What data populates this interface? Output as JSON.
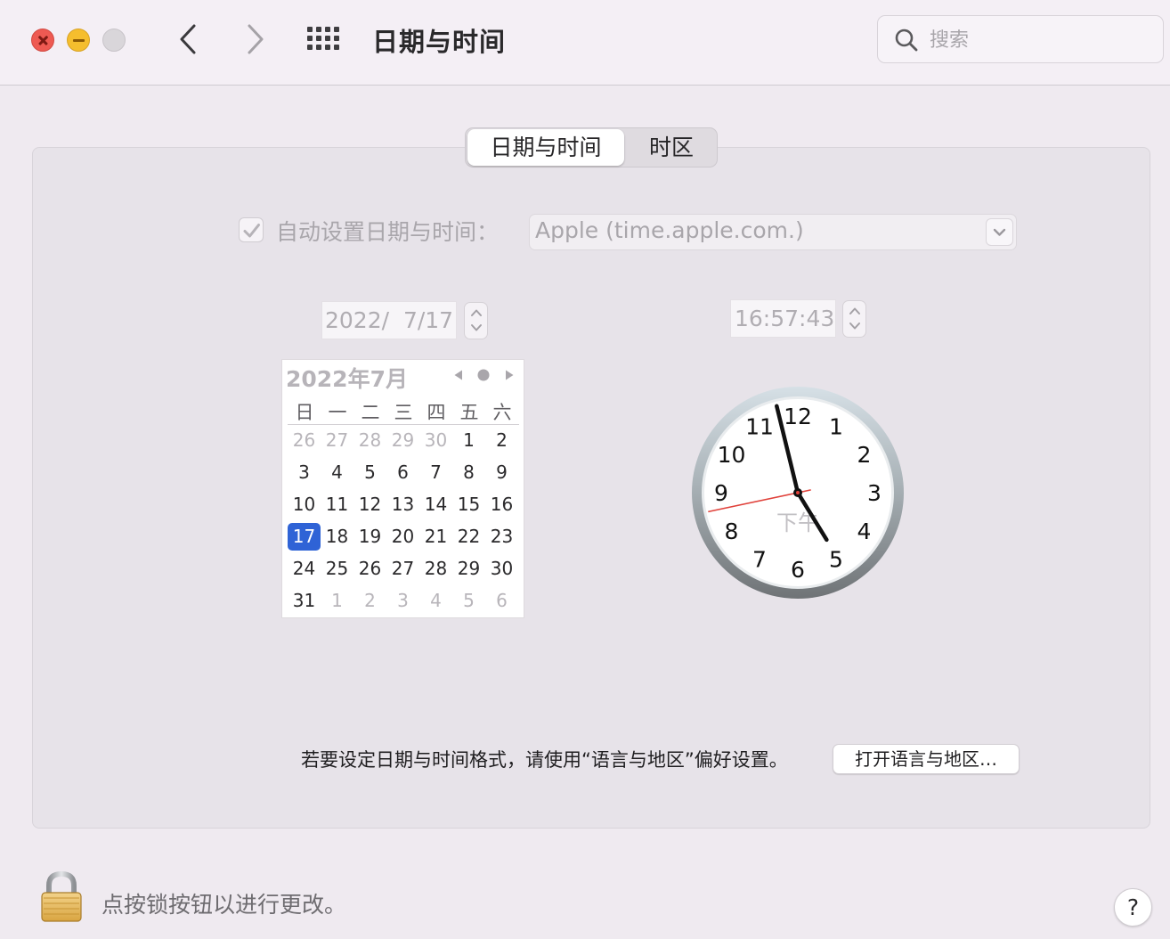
{
  "window": {
    "title": "日期与时间",
    "search_placeholder": "搜索"
  },
  "tabs": [
    {
      "label": "日期与时间",
      "active": true
    },
    {
      "label": "时区",
      "active": false
    }
  ],
  "auto_time": {
    "label": "自动设置日期与时间：",
    "checked": true,
    "server": "Apple (time.apple.com.)"
  },
  "date_field": "2022/  7/17",
  "time_field": "16:57:43",
  "calendar": {
    "title": "2022年7月",
    "weekdays": [
      "日",
      "一",
      "二",
      "三",
      "四",
      "五",
      "六"
    ],
    "weeks": [
      [
        {
          "d": "26",
          "m": true
        },
        {
          "d": "27",
          "m": true
        },
        {
          "d": "28",
          "m": true
        },
        {
          "d": "29",
          "m": true
        },
        {
          "d": "30",
          "m": true
        },
        {
          "d": "1"
        },
        {
          "d": "2"
        }
      ],
      [
        {
          "d": "3"
        },
        {
          "d": "4"
        },
        {
          "d": "5"
        },
        {
          "d": "6"
        },
        {
          "d": "7"
        },
        {
          "d": "8"
        },
        {
          "d": "9"
        }
      ],
      [
        {
          "d": "10"
        },
        {
          "d": "11"
        },
        {
          "d": "12"
        },
        {
          "d": "13"
        },
        {
          "d": "14"
        },
        {
          "d": "15"
        },
        {
          "d": "16"
        }
      ],
      [
        {
          "d": "17",
          "s": true
        },
        {
          "d": "18"
        },
        {
          "d": "19"
        },
        {
          "d": "20"
        },
        {
          "d": "21"
        },
        {
          "d": "22"
        },
        {
          "d": "23"
        }
      ],
      [
        {
          "d": "24"
        },
        {
          "d": "25"
        },
        {
          "d": "26"
        },
        {
          "d": "27"
        },
        {
          "d": "28"
        },
        {
          "d": "29"
        },
        {
          "d": "30"
        }
      ],
      [
        {
          "d": "31"
        },
        {
          "d": "1",
          "m": true
        },
        {
          "d": "2",
          "m": true
        },
        {
          "d": "3",
          "m": true
        },
        {
          "d": "4",
          "m": true
        },
        {
          "d": "5",
          "m": true
        },
        {
          "d": "6",
          "m": true
        }
      ]
    ]
  },
  "clock": {
    "numbers": [
      "12",
      "1",
      "2",
      "3",
      "4",
      "5",
      "6",
      "7",
      "8",
      "9",
      "10",
      "11"
    ],
    "ampm": "下午",
    "hour": 4,
    "minute": 57,
    "second": 43
  },
  "format_note": "若要设定日期与时间格式，请使用“语言与地区”偏好设置。",
  "open_language_button": "打开语言与地区…",
  "lock_text": "点按锁按钮以进行更改。",
  "help_label": "?",
  "colors": {
    "selected_day": "#2f63d6",
    "second_hand": "#e0413a",
    "close": "#ee5a52",
    "minimize": "#f5be2e"
  }
}
